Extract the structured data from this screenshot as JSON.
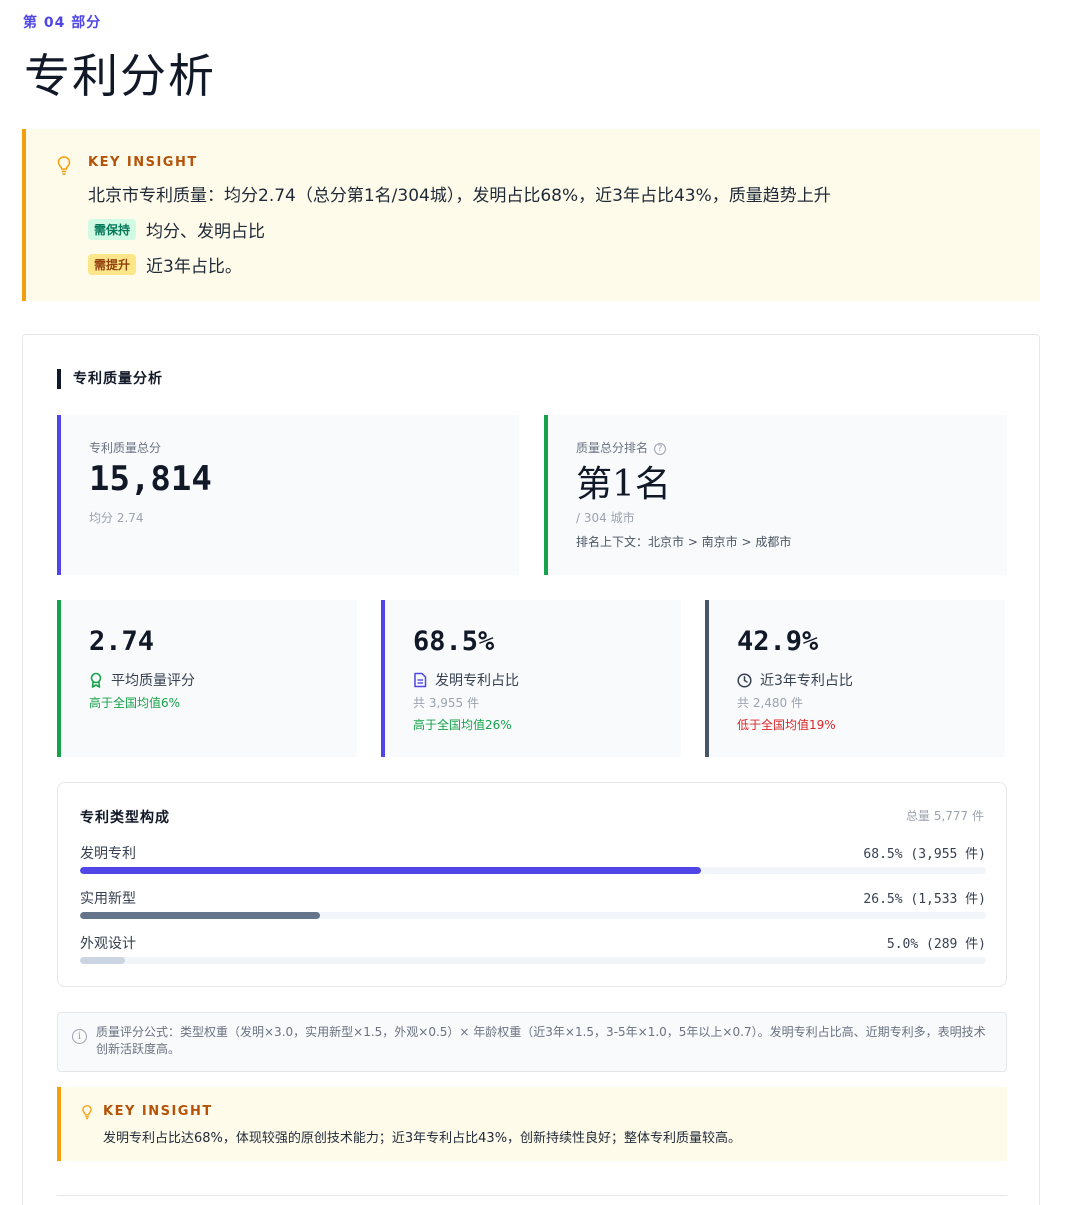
{
  "section": {
    "label": "第 04 部分",
    "title": "专利分析"
  },
  "top_insight": {
    "label": "KEY INSIGHT",
    "text": "北京市专利质量：均分2.74（总分第1名/304城），发明占比68%，近3年占比43%，质量趋势上升",
    "tags": [
      {
        "tag": "需保持",
        "text": "均分、发明占比"
      },
      {
        "tag": "需提升",
        "text": "近3年占比。"
      }
    ]
  },
  "card": {
    "heading": "专利质量分析"
  },
  "total_score": {
    "label": "专利质量总分",
    "value": "15,814",
    "sub": "均分 2.74"
  },
  "rank": {
    "label": "质量总分排名",
    "help": "?",
    "value": "第1名",
    "sub": "/ 304 城市",
    "context": "排名上下文：北京市 > 南京市 > 成都市"
  },
  "metrics": [
    {
      "value": "2.74",
      "label": "平均质量评分",
      "icon": "award-icon",
      "count": "",
      "comparison": "高于全国均值6%",
      "trend": "up",
      "accent": "#16a34a"
    },
    {
      "value": "68.5%",
      "label": "发明专利占比",
      "icon": "document-icon",
      "count": "共 3,955 件",
      "comparison": "高于全国均值26%",
      "trend": "up",
      "accent": "#4f46e5"
    },
    {
      "value": "42.9%",
      "label": "近3年专利占比",
      "icon": "clock-icon",
      "count": "共 2,480 件",
      "comparison": "低于全国均值19%",
      "trend": "down",
      "accent": "#475569"
    }
  ],
  "composition": {
    "title": "专利类型构成",
    "total": "总量 5,777 件",
    "items": [
      {
        "name": "发明专利",
        "stat": "68.5% (3,955 件)",
        "share": 68.5,
        "color": "#4f46e5"
      },
      {
        "name": "实用新型",
        "stat": "26.5% (1,533 件)",
        "share": 26.5,
        "color": "#64748b"
      },
      {
        "name": "外观设计",
        "stat": "5.0% (289 件)",
        "share": 5.0,
        "color": "#cbd5e1"
      }
    ]
  },
  "formula": {
    "text": "质量评分公式：类型权重（发明×3.0，实用新型×1.5，外观×0.5）× 年龄权重（近3年×1.5，3-5年×1.0，5年以上×0.7）。发明专利占比高、近期专利多，表明技术创新活跃度高。"
  },
  "bottom_insight": {
    "label": "KEY INSIGHT",
    "text": "发明专利占比达68%，体现较强的原创技术能力；近3年专利占比43%，创新持续性良好；整体专利质量较高。"
  },
  "colors": {
    "accent": "#4f46e5",
    "success": "#16a34a",
    "warning": "#f59e0b",
    "danger": "#dc2626"
  }
}
